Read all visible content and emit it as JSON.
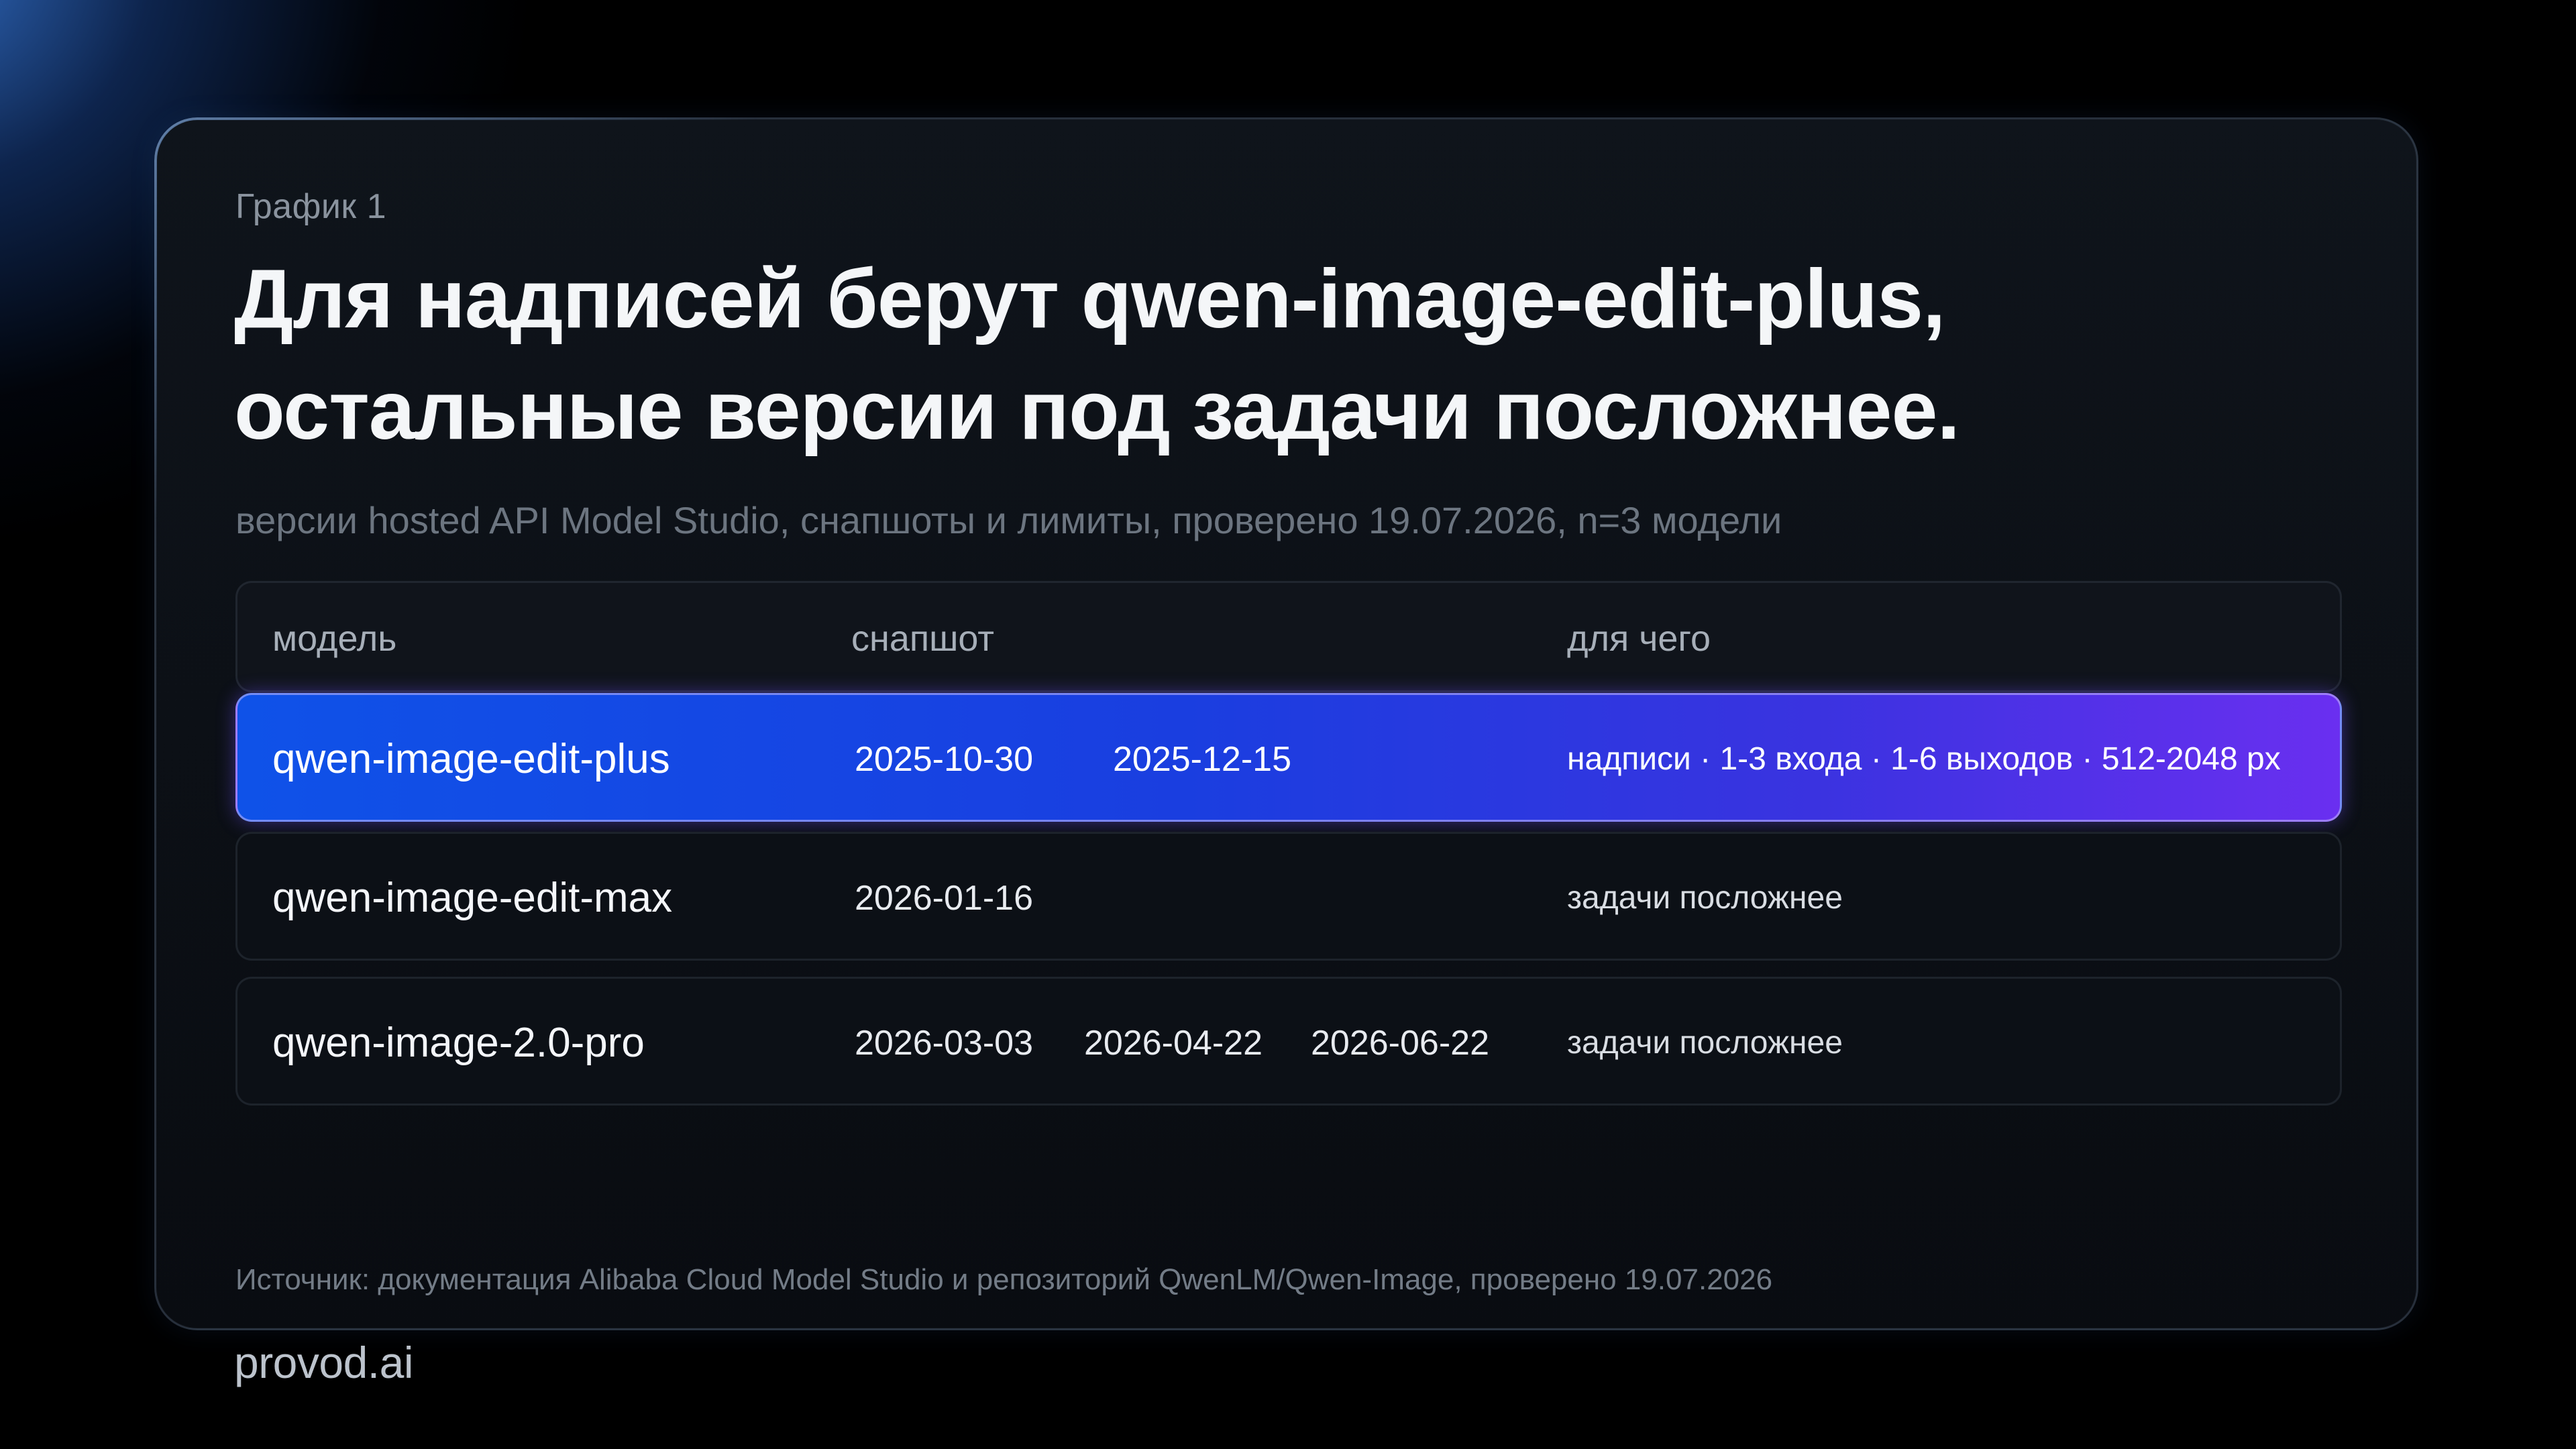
{
  "eyebrow": "График 1",
  "title_line1": "Для надписей берут qwen-image-edit-plus,",
  "title_line2": "остальные версии под задачи посложнее.",
  "subtitle": "версии hosted API Model Studio, снапшоты и лимиты, проверено 19.07.2026, n=3 модели",
  "colors": {
    "background": "#000000",
    "card": "#0c1016",
    "highlight_start": "#0f52e8",
    "highlight_end": "#6a2ff0",
    "title": "#f4f6f8",
    "muted": "#6c7580"
  },
  "chart_data": {
    "type": "table",
    "columns": [
      "модель",
      "снапшот",
      "для чего"
    ],
    "rows": [
      {
        "model": "qwen-image-edit-plus",
        "snapshots": [
          "2025-10-30",
          "2025-12-15"
        ],
        "purpose": "надписи · 1-3 входа · 1-6 выходов · 512-2048 px",
        "highlighted": true
      },
      {
        "model": "qwen-image-edit-max",
        "snapshots": [
          "2026-01-16"
        ],
        "purpose": "задачи посложнее",
        "highlighted": false
      },
      {
        "model": "qwen-image-2.0-pro",
        "snapshots": [
          "2026-03-03",
          "2026-04-22",
          "2026-06-22"
        ],
        "purpose": "задачи посложнее",
        "highlighted": false
      }
    ]
  },
  "source": "Источник: документация Alibaba Cloud Model Studio и репозиторий QwenLM/Qwen-Image, проверено 19.07.2026",
  "logo": "provod.ai"
}
